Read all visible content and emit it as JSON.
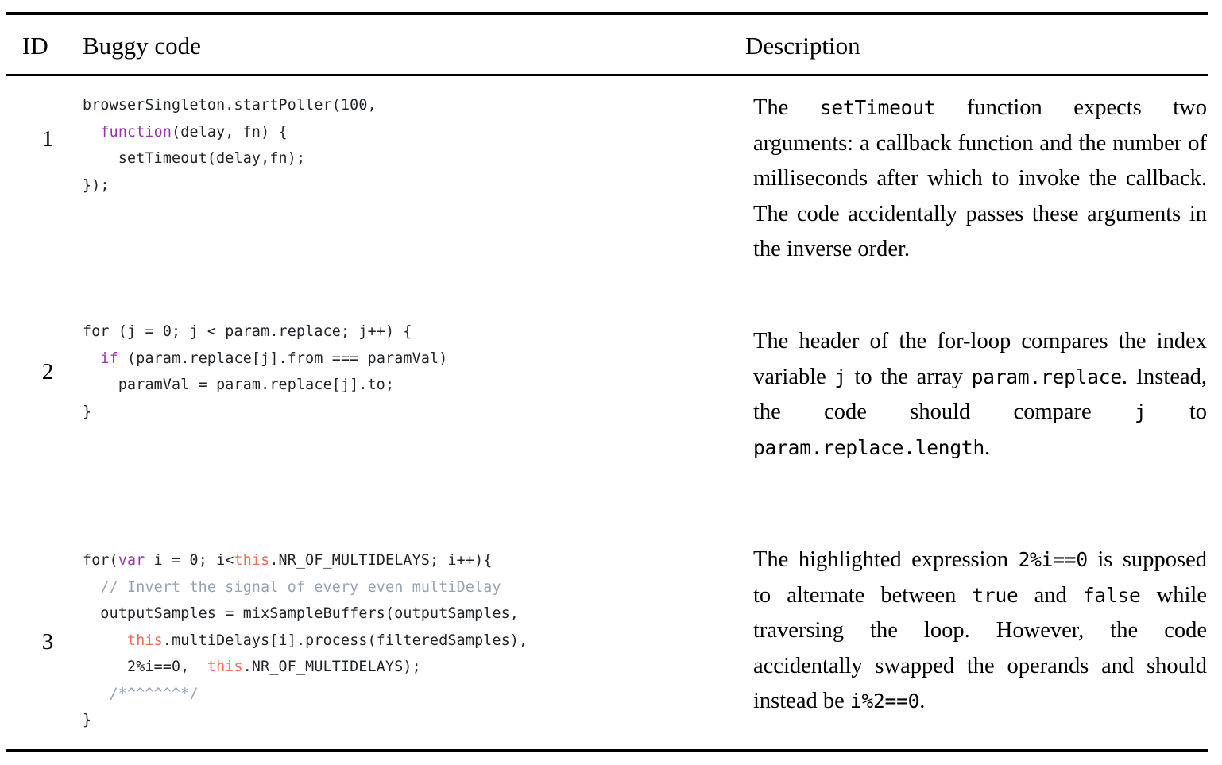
{
  "table": {
    "columns": {
      "id": "ID",
      "code": "Buggy code",
      "description": "Description"
    },
    "colors": {
      "rule": "#000000",
      "code_default": "#1f2328",
      "keyword": "#9933aa",
      "this_keyword": "#ee6a5a",
      "comment": "#96a2b3",
      "text": "#000000",
      "background": "#ffffff"
    },
    "rows": [
      {
        "id": "1",
        "code_lines": [
          [
            {
              "t": "browserSingleton.startPoller(100,",
              "c": "plain"
            }
          ],
          [
            {
              "t": "  ",
              "c": "plain"
            },
            {
              "t": "function",
              "c": "kw"
            },
            {
              "t": "(delay, fn) {",
              "c": "plain"
            }
          ],
          [
            {
              "t": "    setTimeout(delay,fn);",
              "c": "plain"
            }
          ],
          [
            {
              "t": "});",
              "c": "plain"
            }
          ]
        ],
        "code_plain": "browserSingleton.startPoller(100,\n  function(delay, fn) {\n    setTimeout(delay,fn);\n});",
        "description_parts": [
          {
            "t": "The ",
            "m": false
          },
          {
            "t": "setTimeout",
            "m": true
          },
          {
            "t": " function expects two arguments: a callback function and the number of milliseconds after which to invoke the callback. The code accidentally passes these arguments in the inverse order.",
            "m": false
          }
        ],
        "description_plain": "The setTimeout function expects two arguments: a callback function and the number of milliseconds after which to invoke the callback. The code accidentally passes these arguments in the inverse order."
      },
      {
        "id": "2",
        "code_lines": [
          [
            {
              "t": "for (j = 0; j < param.replace; j++) {",
              "c": "plain"
            }
          ],
          [
            {
              "t": "  ",
              "c": "plain"
            },
            {
              "t": "if",
              "c": "kw"
            },
            {
              "t": " (param.replace[j].from === paramVal)",
              "c": "plain"
            }
          ],
          [
            {
              "t": "    paramVal = param.replace[j].to;",
              "c": "plain"
            }
          ],
          [
            {
              "t": "}",
              "c": "plain"
            }
          ]
        ],
        "code_plain": "for (j = 0; j < param.replace; j++) {\n  if (param.replace[j].from === paramVal)\n    paramVal = param.replace[j].to;\n}",
        "description_parts": [
          {
            "t": "The header of the for-loop compares the index variable ",
            "m": false
          },
          {
            "t": "j",
            "m": true
          },
          {
            "t": " to the array ",
            "m": false
          },
          {
            "t": "param.replace",
            "m": true
          },
          {
            "t": ". Instead, the code should compare ",
            "m": false
          },
          {
            "t": "j",
            "m": true
          },
          {
            "t": " to ",
            "m": false
          },
          {
            "t": "param.replace.length",
            "m": true
          },
          {
            "t": ".",
            "m": false
          }
        ],
        "description_plain": "The header of the for-loop compares the index variable j to the array param.replace. Instead, the code should compare j to param.replace.length."
      },
      {
        "id": "3",
        "code_lines": [
          [
            {
              "t": "for(",
              "c": "plain"
            },
            {
              "t": "var",
              "c": "kw"
            },
            {
              "t": " i = 0; i<",
              "c": "plain"
            },
            {
              "t": "this",
              "c": "this"
            },
            {
              "t": ".NR_OF_MULTIDELAYS; i++){",
              "c": "plain"
            }
          ],
          [
            {
              "t": "  // Invert the signal of every even multiDelay",
              "c": "comment"
            }
          ],
          [
            {
              "t": "  outputSamples = mixSampleBuffers(outputSamples,",
              "c": "plain"
            }
          ],
          [
            {
              "t": "     ",
              "c": "plain"
            },
            {
              "t": "this",
              "c": "this"
            },
            {
              "t": ".multiDelays[i].process(filteredSamples),",
              "c": "plain"
            }
          ],
          [
            {
              "t": "     2%i==0,  ",
              "c": "plain"
            },
            {
              "t": "this",
              "c": "this"
            },
            {
              "t": ".NR_OF_MULTIDELAYS);",
              "c": "plain"
            }
          ],
          [
            {
              "t": "   /*^^^^^^*/",
              "c": "comment"
            }
          ],
          [
            {
              "t": "}",
              "c": "plain"
            }
          ]
        ],
        "code_plain": "for(var i = 0; i<this.NR_OF_MULTIDELAYS; i++){\n  // Invert the signal of every even multiDelay\n  outputSamples = mixSampleBuffers(outputSamples,\n     this.multiDelays[i].process(filteredSamples),\n     2%i==0,  this.NR_OF_MULTIDELAYS);\n   /*^^^^^^*/\n}",
        "description_parts": [
          {
            "t": "The highlighted expression ",
            "m": false
          },
          {
            "t": "2%i==0",
            "m": true
          },
          {
            "t": " is supposed to alternate between ",
            "m": false
          },
          {
            "t": "true",
            "m": true
          },
          {
            "t": " and ",
            "m": false
          },
          {
            "t": "false",
            "m": true
          },
          {
            "t": " while traversing the loop. However, the code accidentally swapped the operands and should instead be ",
            "m": false
          },
          {
            "t": "i%2==0",
            "m": true
          },
          {
            "t": ".",
            "m": false
          }
        ],
        "description_plain": "The highlighted expression 2%i==0 is supposed to alternate between true and false while traversing the loop. However, the code accidentally swapped the operands and should instead be i%2==0."
      }
    ]
  }
}
